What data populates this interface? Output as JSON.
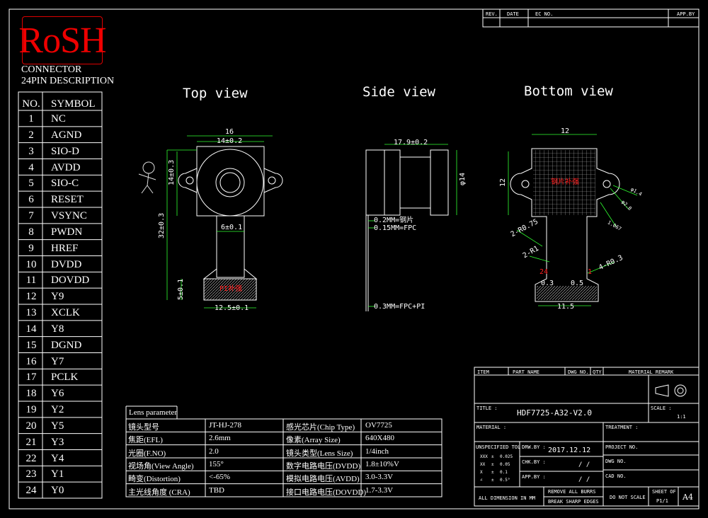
{
  "logo": "RoSH",
  "connector_title": [
    "CONNECTOR",
    "24PIN DESCRIPTION"
  ],
  "pin_table": {
    "headers": [
      "NO.",
      "SYMBOL"
    ],
    "rows": [
      [
        "1",
        "NC"
      ],
      [
        "2",
        "AGND"
      ],
      [
        "3",
        "SIO-D"
      ],
      [
        "4",
        "AVDD"
      ],
      [
        "5",
        "SIO-C"
      ],
      [
        "6",
        "RESET"
      ],
      [
        "7",
        "VSYNC"
      ],
      [
        "8",
        "PWDN"
      ],
      [
        "9",
        "HREF"
      ],
      [
        "10",
        "DVDD"
      ],
      [
        "11",
        "DOVDD"
      ],
      [
        "12",
        "Y9"
      ],
      [
        "13",
        "XCLK"
      ],
      [
        "14",
        "Y8"
      ],
      [
        "15",
        "DGND"
      ],
      [
        "16",
        "Y7"
      ],
      [
        "17",
        "PCLK"
      ],
      [
        "18",
        "Y6"
      ],
      [
        "19",
        "Y2"
      ],
      [
        "20",
        "Y5"
      ],
      [
        "21",
        "Y3"
      ],
      [
        "22",
        "Y4"
      ],
      [
        "23",
        "Y1"
      ],
      [
        "24",
        "Y0"
      ]
    ]
  },
  "views": {
    "top": "Top view",
    "side": "Side view",
    "bottom": "Bottom view"
  },
  "top_view_dims": {
    "width": "16",
    "hole_pitch": "14±0.2",
    "height_lens": "14±0.3",
    "total_length": "32±0.3",
    "fpc_width": "6±0.1",
    "stiffener_height": "5±0.1",
    "stiffener_width": "12.5±0.1",
    "pi_label": "PI补强"
  },
  "side_view_dims": {
    "length": "17.9±0.2",
    "diameter": "φ14",
    "layer1": "0.2MM=钢片",
    "layer2": "0.15MM=FPC",
    "layer3": "0.3MM=FPC+PI"
  },
  "bottom_view_dims": {
    "width": "12",
    "height": "12",
    "steel_label": "钢片补强",
    "r1": "2-R0.75",
    "r2": "2-R1",
    "r3": "4-R0.3",
    "d1": "φ1.4",
    "d2": "φ2.8",
    "d3": "1.067",
    "pitch_left": "0.3",
    "pitch": "0.5",
    "fpc_total": "11.5",
    "pin1": "1",
    "pin24": "24"
  },
  "lens_parameter": {
    "title": "Lens parameter",
    "rows": [
      [
        "镜头型号",
        "JT-HJ-278",
        "感光芯片(Chip Type)",
        "OV7725"
      ],
      [
        "焦距(EFL)",
        "2.6mm",
        "像素(Array Size)",
        "640X480"
      ],
      [
        "光圈(F.NO)",
        "2.0",
        "镜头类型(Lens Size)",
        "1/4inch"
      ],
      [
        "视场角(View Angle)",
        "155°",
        "数字电路电压(DVDD)",
        "1.8±10%V"
      ],
      [
        "畸变(Distortion)",
        "<-65%",
        "模拟电路电压(AVDD)",
        "3.0-3.3V"
      ],
      [
        "主光线角度 (CRA)",
        "TBD",
        "接口电路电压(DOVDD)",
        "1.7-3.3V"
      ]
    ]
  },
  "revision_block": {
    "headers": [
      "REV.",
      "DATE",
      "EC NO.",
      "APP.BY"
    ]
  },
  "title_block": {
    "bom_headers": [
      "ITEM",
      "PART NAME",
      "DWG NO.",
      "QTY",
      "MATERIAL REMARK"
    ],
    "title_label": "TITLE :",
    "title_value": "HDF7725-A32-V2.0",
    "scale_label": "SCALE :",
    "scale_value": "1:1",
    "material_label": "MATERIAL :",
    "treatment_label": "TREATMENT :",
    "tolerance_label": "UNSPECIFIED TOL",
    "tolerances": [
      [
        "XXX",
        "±",
        "0.025"
      ],
      [
        "XX",
        "±",
        "0.05"
      ],
      [
        "X",
        "±",
        "0.1"
      ],
      [
        "∠",
        "±",
        "0.5°"
      ]
    ],
    "drawn_label": "DRW.BY :",
    "drawn_date": "2017.12.12",
    "chk_label": "CHK.BY :",
    "chk_date": "/  /",
    "app_label": "APP.BY :",
    "app_date": "/  /",
    "project_label": "PROJECT NO.",
    "dwg_label": "DWG NO.",
    "cad_label": "CAD NO.",
    "dimension_note": "ALL DIMENSION IN MM",
    "remove_burrs": "REMOVE ALL BURRS",
    "break_edges": "BREAK SHARP EDGES",
    "do_not_scale": "DO NOT SCALE",
    "sheet_label": "SHEET OF",
    "sheet_value": "P1/1",
    "size": "A4"
  },
  "colors": {
    "line": "#ffffff",
    "accent_red": "#ff2020",
    "dim_cyan": "#20e8e8",
    "dim_green": "#30ff30"
  }
}
